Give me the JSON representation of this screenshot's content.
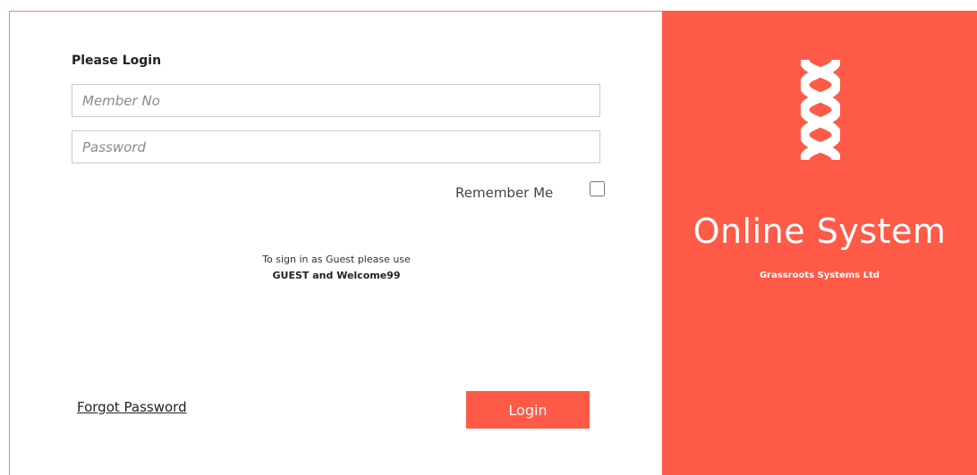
{
  "login_form": {
    "heading": "Please Login",
    "member_no_placeholder": "Member No",
    "member_no_value": "",
    "password_placeholder": "Password",
    "password_value": "",
    "remember_me_label": "Remember Me",
    "remember_me_checked": false,
    "guest_hint": "To sign in as Guest please use",
    "guest_credentials": "GUEST and Welcome99",
    "forgot_password_label": "Forgot Password",
    "login_button_label": "Login"
  },
  "brand": {
    "logo_icon": "helix-logo-icon",
    "app_title": "Online System",
    "company_name": "Grassroots Systems Ltd",
    "accent_color": "#ff5a47",
    "border_color": "#f4857a"
  }
}
